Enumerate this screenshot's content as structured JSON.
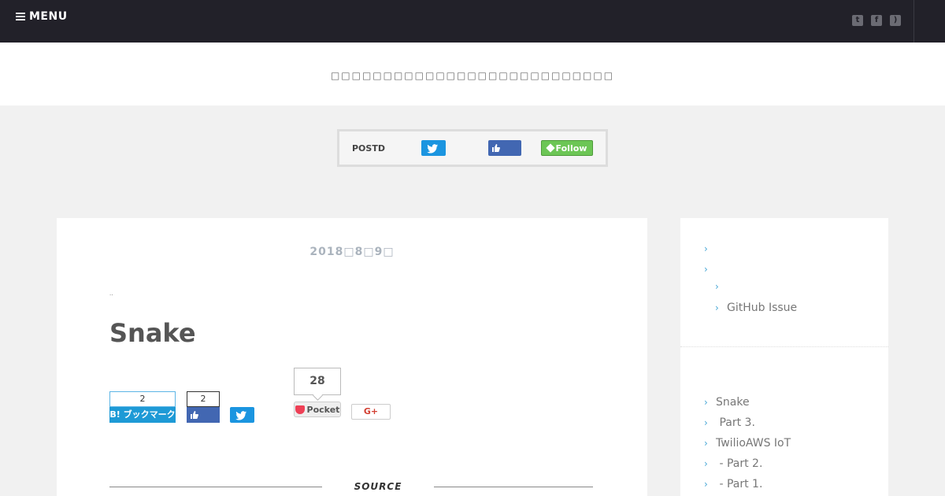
{
  "topbar": {
    "menu_label": "MENU",
    "social_icons": [
      "twitter-icon",
      "facebook-icon",
      "rss-icon"
    ]
  },
  "header": {
    "tagline": "□□□□□□□□□□□□□□□□□□□□□□□□□□□"
  },
  "follow_box": {
    "label": "POSTD",
    "feedly_label": "Follow"
  },
  "post": {
    "date": "2018□8□9□",
    "breadcrumb": "..",
    "title": "Snake",
    "share": {
      "hatena_count": "2",
      "hatena_label": "B! ブックマーク",
      "facebook_count": "2",
      "pocket_count": "28",
      "pocket_label": "Pocket",
      "gplus_label": "G+"
    },
    "source_label": "SOURCE"
  },
  "sidebar": {
    "top_items": [
      {
        "label": ""
      },
      {
        "label": ""
      },
      {
        "label": ""
      },
      {
        "label": "GitHub Issue"
      }
    ],
    "recent_items": [
      {
        "label": "Snake"
      },
      {
        "label": " Part 3."
      },
      {
        "label": "TwilioAWS IoT"
      },
      {
        "label": " - Part 2."
      },
      {
        "label": " - Part 1."
      }
    ]
  },
  "colors": {
    "topbar": "#222129",
    "twitter": "#1b95e0",
    "facebook": "#4267b2",
    "hatena": "#1e9ad6",
    "feedly": "#6cc655",
    "pocket": "#ee4056",
    "chevron": "#48a7d6"
  }
}
